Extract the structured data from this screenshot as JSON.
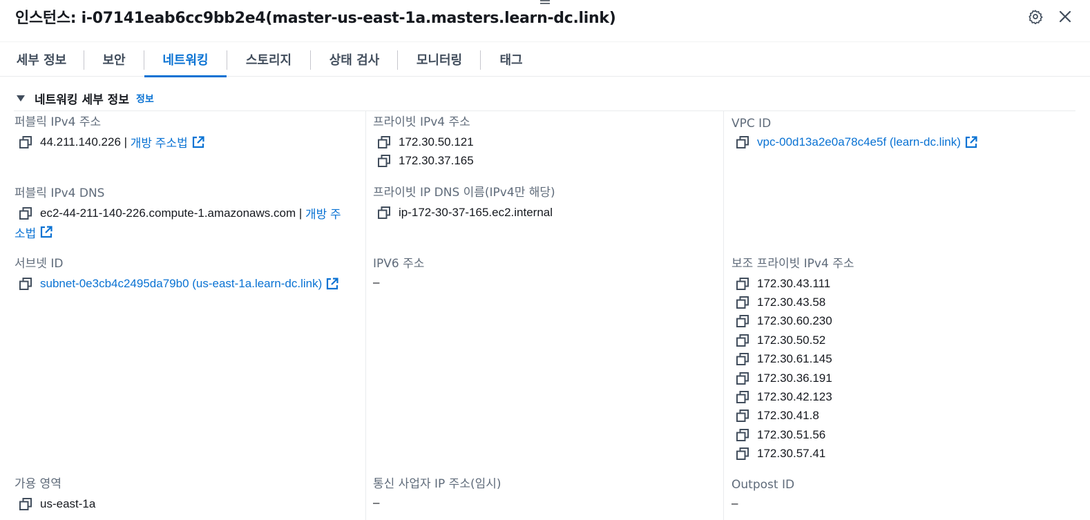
{
  "header": {
    "title": "인스턴스: i-07141eab6cc9bb2e4(master-us-east-1a.masters.learn-dc.link)"
  },
  "tabs": [
    {
      "label": "세부 정보"
    },
    {
      "label": "보안"
    },
    {
      "label": "네트워킹",
      "active": true
    },
    {
      "label": "스토리지"
    },
    {
      "label": "상태 검사"
    },
    {
      "label": "모니터링"
    },
    {
      "label": "태그"
    }
  ],
  "section": {
    "title": "네트워킹 세부 정보",
    "info_link": "정보"
  },
  "fields": {
    "public_ipv4": {
      "label": "퍼블릭 IPv4 주소",
      "value": "44.211.140.226",
      "separator": " | ",
      "link": "개방 주소법"
    },
    "private_ipv4": {
      "label": "프라이빗 IPv4 주소",
      "values": [
        "172.30.50.121",
        "172.30.37.165"
      ]
    },
    "vpc_id": {
      "label": "VPC ID",
      "link": "vpc-00d13a2e0a78c4e5f (learn-dc.link)"
    },
    "public_dns": {
      "label": "퍼블릭 IPv4 DNS",
      "value": "ec2-44-211-140-226.compute-1.amazonaws.com",
      "separator": " | ",
      "link_line1": "개방 주",
      "link_line2": "소법"
    },
    "private_dns": {
      "label": "프라이빗 IP DNS 이름(IPv4만 해당)",
      "value": "ip-172-30-37-165.ec2.internal"
    },
    "subnet_id": {
      "label": "서브넷 ID",
      "link": "subnet-0e3cb4c2495da79b0 (us-east-1a.learn-dc.link)"
    },
    "ipv6": {
      "label": "IPV6 주소",
      "value": "–"
    },
    "secondary_private_ipv4": {
      "label": "보조 프라이빗 IPv4 주소",
      "values": [
        "172.30.43.111",
        "172.30.43.58",
        "172.30.60.230",
        "172.30.50.52",
        "172.30.61.145",
        "172.30.36.191",
        "172.30.42.123",
        "172.30.41.8",
        "172.30.51.56",
        "172.30.57.41"
      ]
    },
    "availability_zone": {
      "label": "가용 영역",
      "value": "us-east-1a"
    },
    "carrier_ip": {
      "label": "통신 사업자 IP 주소(임시)",
      "value": "–"
    },
    "outpost_id": {
      "label": "Outpost ID",
      "value": "–"
    }
  },
  "icons": {
    "copy": "copy-icon",
    "external": "external-link-icon",
    "settings": "gear-icon",
    "close": "close-icon",
    "caret": "caret-down-icon"
  },
  "colors": {
    "link": "#0972d3",
    "label": "#5f6b7a",
    "text": "#16191f",
    "active_tab": "#0972d3"
  }
}
